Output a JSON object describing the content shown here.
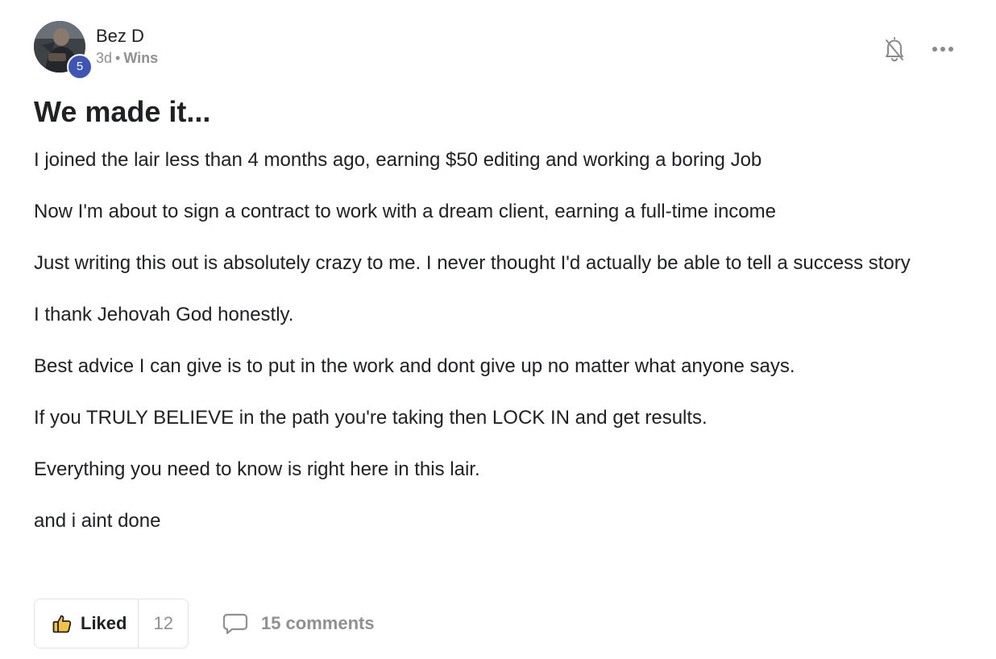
{
  "author": {
    "name": "Bez D",
    "level": "5",
    "time_ago": "3d",
    "separator": "•",
    "category": "Wins"
  },
  "actions": {
    "bell_icon": "bell-off-icon",
    "more_icon": "more-horizontal-icon"
  },
  "post": {
    "title": "We made it...",
    "paragraphs": [
      "I joined the lair less than 4 months ago, earning $50 editing and working a boring Job",
      "Now I'm about to sign a contract to work with a dream client, earning a full-time income",
      "Just writing this out is absolutely crazy to me. I never thought I'd actually be able to tell a success story",
      "I thank Jehovah God honestly.",
      "Best advice I can give is to put in the work and dont give up no matter what anyone says.",
      "If you TRULY BELIEVE in the path you're taking then LOCK IN and get results.",
      "Everything you need to know is right here in this lair.",
      "and i aint done"
    ]
  },
  "footer": {
    "like_label": "Liked",
    "like_count": "12",
    "comments_label": "15 comments",
    "like_icon": "thumbs-up-icon",
    "comment_icon": "comment-bubble-icon"
  },
  "colors": {
    "badge": "#3f55b5",
    "like_icon_fill": "#f5c242",
    "muted_text": "#909090"
  }
}
